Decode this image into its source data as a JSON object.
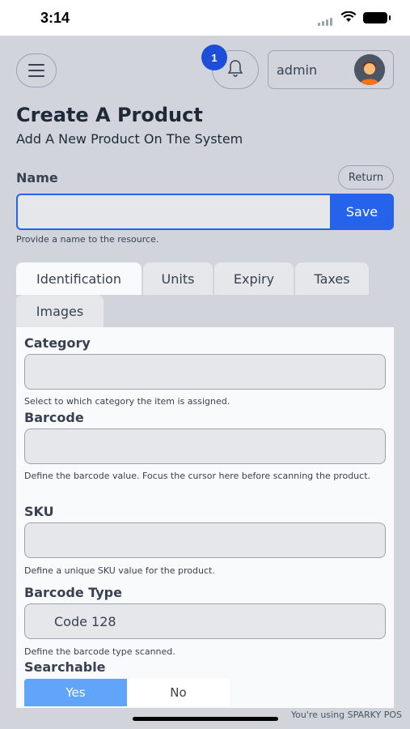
{
  "status_bar": {
    "time": "3:14"
  },
  "header": {
    "notification_count": "1",
    "user_name": "admin"
  },
  "page": {
    "title": "Create A Product",
    "subtitle": "Add A New Product On The System"
  },
  "name_field": {
    "label": "Name",
    "return_label": "Return",
    "value": "",
    "save_label": "Save",
    "help": "Provide a name to the resource."
  },
  "tabs": [
    {
      "label": "Identification",
      "active": true
    },
    {
      "label": "Units"
    },
    {
      "label": "Expiry"
    },
    {
      "label": "Taxes"
    },
    {
      "label": "Images"
    }
  ],
  "fields": {
    "category": {
      "label": "Category",
      "value": "",
      "help": "Select to which category the item is assigned."
    },
    "barcode": {
      "label": "Barcode",
      "value": "",
      "help": "Define the barcode value. Focus the cursor here before scanning the product."
    },
    "sku": {
      "label": "SKU",
      "value": "",
      "help": "Define a unique SKU value for the product."
    },
    "barcode_type": {
      "label": "Barcode Type",
      "value": "Code 128",
      "help": "Define the barcode type scanned."
    },
    "searchable": {
      "label": "Searchable",
      "yes_label": "Yes",
      "no_label": "No",
      "selected": "Yes"
    }
  },
  "footer": {
    "note": "You're using SPARKY POS"
  },
  "colors": {
    "accent": "#2563eb",
    "toggle_active": "#60a5fa",
    "background": "#d1d5db"
  }
}
